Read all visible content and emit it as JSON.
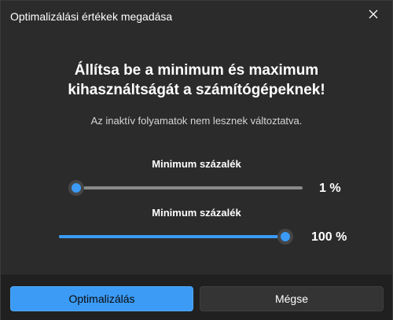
{
  "dialog": {
    "title": "Optimalizálási értékek megadása",
    "close_icon": "close-icon"
  },
  "main": {
    "headline_line1": "Állítsa be a minimum és maximum",
    "headline_line2": "kihasználtságát a számítógépeknek!",
    "subtext": "Az inaktív folyamatok nem lesznek változtatva."
  },
  "sliders": [
    {
      "label": "Minimum százalék",
      "value": 1,
      "value_text": "1 %"
    },
    {
      "label": "Minimum százalék",
      "value": 100,
      "value_text": "100 %"
    }
  ],
  "buttons": {
    "optimize_label": "Optimalizálás",
    "cancel_label": "Mégse"
  },
  "colors": {
    "accent": "#3b9bf5",
    "background": "#2b2b2b",
    "footer": "#202020"
  }
}
